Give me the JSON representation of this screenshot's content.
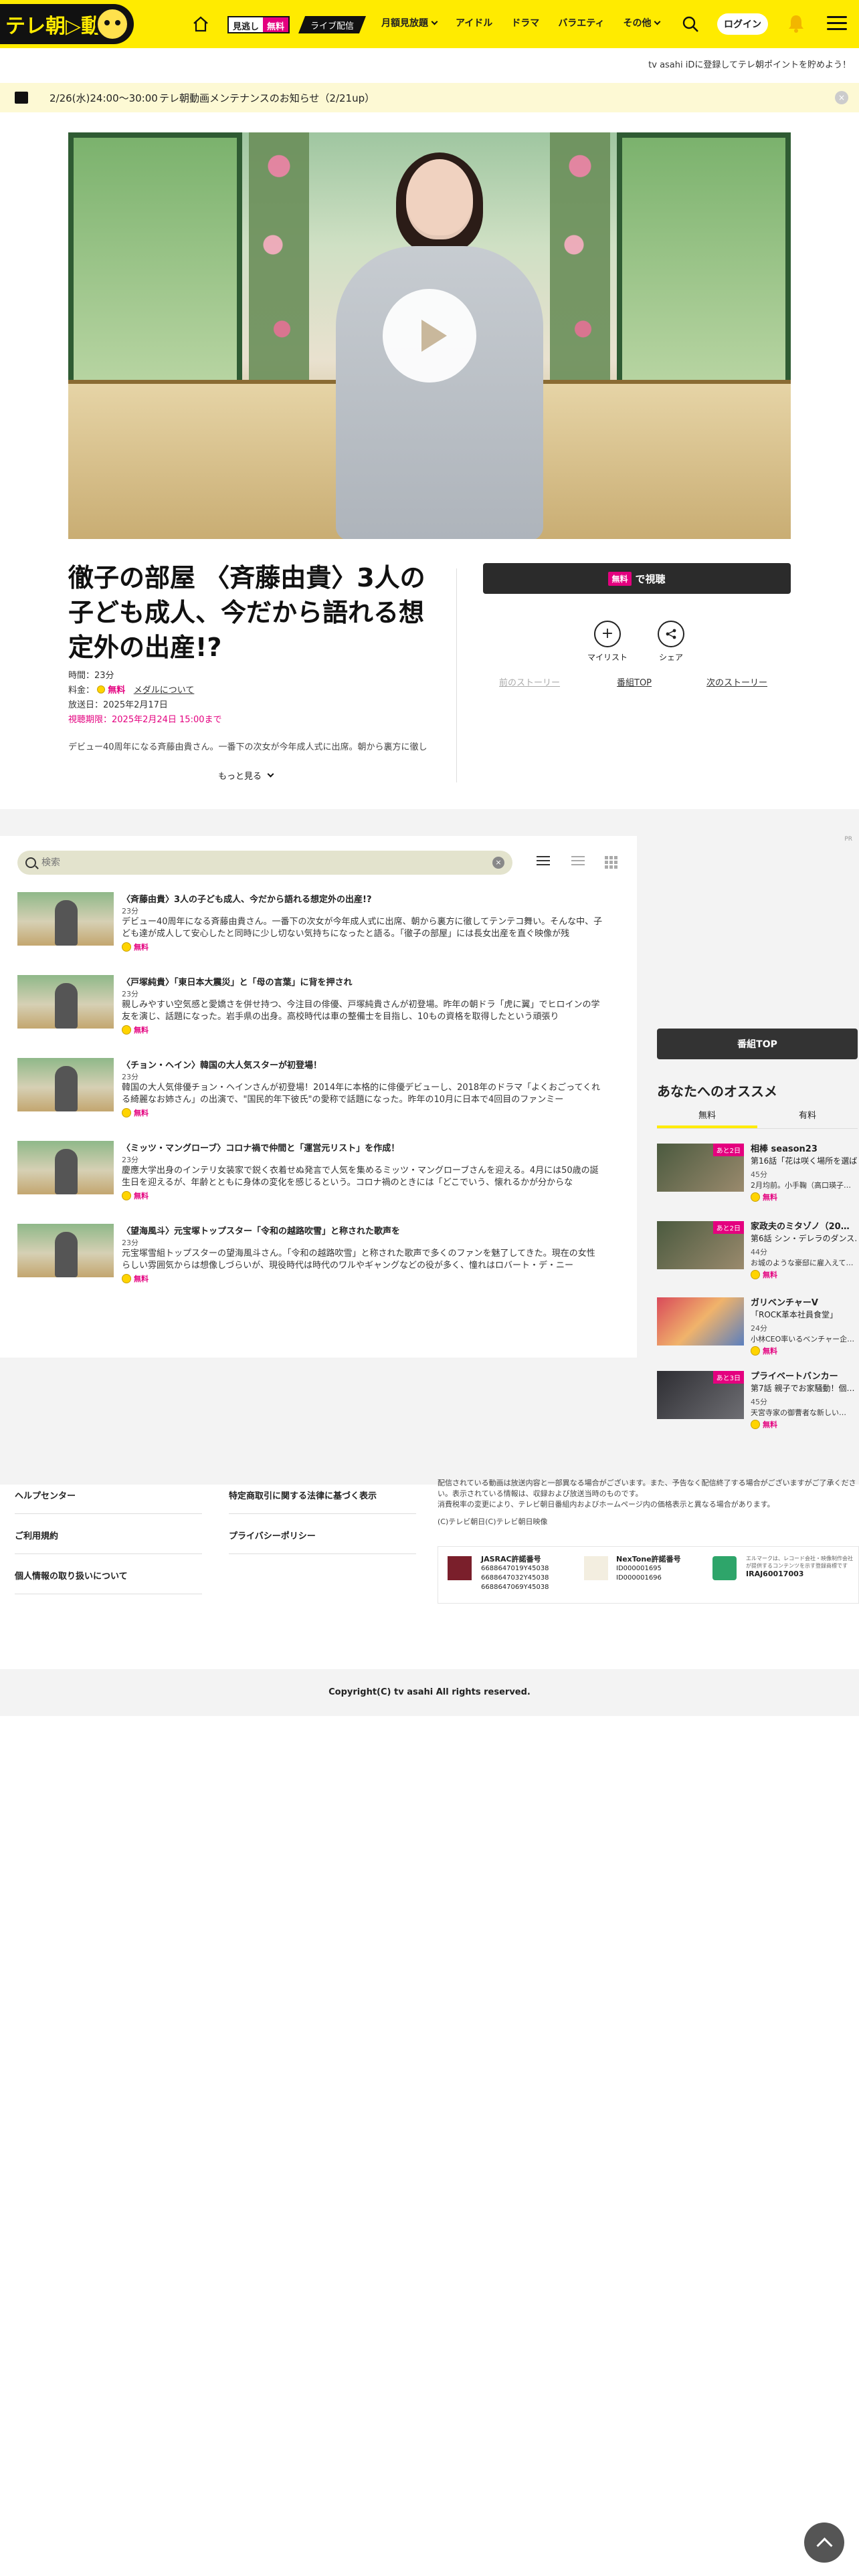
{
  "header": {
    "logo": "テレ朝▷動画",
    "mi_badge": "見逃し",
    "mi_free": "無料",
    "live_badge": "ライブ配信",
    "nav": [
      {
        "label": "月額見放題",
        "has_dropdown": true
      },
      {
        "label": "アイドル",
        "has_dropdown": false
      },
      {
        "label": "ドラマ",
        "has_dropdown": false
      },
      {
        "label": "バラエティ",
        "has_dropdown": false
      },
      {
        "label": "その他",
        "has_dropdown": true
      }
    ],
    "login_label": "ログイン",
    "accent": "#ffeb00"
  },
  "promo_text": "tv asahi iDに登録してテレ朝ポイントを貯めよう！",
  "notice": {
    "date": "2/26(水)24:00〜30:00",
    "text": "テレ朝動画メンテナンスのお知らせ（2/21up）",
    "close": "×"
  },
  "episode": {
    "title": "徹子の部屋 〈斉藤由貴〉3人の子ども成人、今だから語れる想定外の出産!?",
    "duration_label": "時間：23分",
    "fee_label": "料金：",
    "fee_value": "無料",
    "fee_link": "メダルについて",
    "aired": "放送日：2025年2月17日",
    "deadline": "視聴期限：2025年2月24日 15:00まで",
    "description": "デビュー40周年になる斉藤由貴さん。一番下の次女が今年成人式に出席。朝から裏方に徹し",
    "more_label": "もっと見る",
    "watch_free_badge": "無料",
    "watch_label": "で視聴",
    "mylist_label": "マイリスト",
    "share_label": "シェア",
    "prev_label": "前のストーリー",
    "top_label": "番組TOP",
    "next_label": "次のストーリー"
  },
  "corner_tag": "PR",
  "episode_list": {
    "search_placeholder": "検索",
    "items": [
      {
        "title": "〈斉藤由貴〉3人の子ども成人、今だから語れる想定外の出産!?",
        "duration": "23分",
        "desc": "デビュー40周年になる斉藤由貴さん。一番下の次女が今年成人式に出席、朝から裏方に徹してテンテコ舞い。そんな中、子ども達が成人して安心したと同時に少し切ない気持ちになったと語る。「徹子の部屋」には長女出産を直ぐ映像が残",
        "free": "無料"
      },
      {
        "title": "〈戸塚純貴〉「東日本大震災」と「母の言葉」に背を押され",
        "duration": "23分",
        "desc": "親しみやすい空気感と愛嬌さを併せ持つ、今注目の俳優、戸塚純貴さんが初登場。昨年の朝ドラ「虎に翼」でヒロインの学友を演じ、話題になった。岩手県の出身。高校時代は車の整備士を目指し、10もの資格を取得したという頑張り",
        "free": "無料"
      },
      {
        "title": "〈チョン・ヘイン〉韓国の大人気スターが初登場！",
        "duration": "23分",
        "desc": "韓国の大人気俳優チョン・ヘインさんが初登場！2014年に本格的に俳優デビューし、2018年のドラマ「よくおごってくれる綺麗なお姉さん」の出演で、\"国民的年下彼氏\"の愛称で話題になった。昨年の10月に日本で4回目のファンミー",
        "free": "無料"
      },
      {
        "title": "〈ミッツ・マングローブ〉コロナ禍で仲間と「運営元リスト」を作成！",
        "duration": "23分",
        "desc": "慶應大学出身のインテリ女装家で鋭く衣着せぬ発言で人気を集めるミッツ・マングローブさんを迎える。4月には50歳の誕生日を迎えるが、年齢とともに身体の変化を感じるという。コロナ禍のときには「どこでいう、懐れるかが分からな",
        "free": "無料"
      },
      {
        "title": "〈望海風斗〉元宝塚トップスター「令和の越路吹雪」と称された歌声を",
        "duration": "23分",
        "desc": "元宝塚雪組トップスターの望海風斗さん。「令和の越路吹雪」と称された歌声で多くのファンを魅了してきた。現在の女性らしい雰囲気からは想像しづらいが、現役時代は時代のワルやギャングなどの役が多く、憧れはロバート・デ・ニー",
        "free": "無料"
      }
    ]
  },
  "sidebar": {
    "top_button": "番組TOP",
    "rec_title": "あなたへのオススメ",
    "tabs": [
      "無料",
      "有料"
    ],
    "items": [
      {
        "badge": "あと2日",
        "title": "相棒 season23",
        "sub": "第16話「花は咲く場所を選ば…",
        "duration": "45分",
        "extra": "2月均前。小手鞠（高口瑛子…",
        "free": "無料"
      },
      {
        "badge": "あと2日",
        "title": "家政夫のミタゾノ（20…",
        "sub": "第6話 シン・デレラのダンス…",
        "duration": "44分",
        "extra": "お城のような豪邸に雇入えて…",
        "free": "無料"
      },
      {
        "badge": "",
        "title": "ガリベンチャーV",
        "sub": "「ROCK革本社員食堂」",
        "duration": "24分",
        "extra": "小林CEO率いるベンチャー企…",
        "free": "無料"
      },
      {
        "badge": "あと3日",
        "title": "プライベートバンカー",
        "sub": "第7話 親子でお家騒動！個…",
        "duration": "45分",
        "extra": "天宮寺家の御曹者な新しい…",
        "free": "無料"
      }
    ]
  },
  "footer": {
    "links": [
      "ヘルプセンター",
      "特定商取引に関する法律に基づく表示",
      "ご利用規約",
      "プライバシーポリシー",
      "個人情報の取り扱いについて"
    ],
    "note1": "配信されている動画は放送内容と一部異なる場合がございます。また、予告なく配信終了する場合がございますがご了承ください。表示されている情報は、収録および放送当時のものです。",
    "note2": "消費税率の変更により、テレビ朝日番組内およびホームページ内の価格表示と異なる場合があります。",
    "note3": "(C)テレビ朝日(C)テレビ朝日映像",
    "jasrac_title": "JASRAC許諾番号",
    "jasrac_nums": [
      "6688647019Y45038",
      "6688647032Y45038",
      "6688647069Y45038"
    ],
    "nextone_title": "NexTone許諾番号",
    "nextone_nums": [
      "ID000001695",
      "ID000001696"
    ],
    "lmark_text": "エルマークは、レコード会社・映像制作会社が提供するコンテンツを示す登録商標です",
    "lmark_num": "IRAJ60017003",
    "copyright": "Copyright(C) tv asahi All rights reserved."
  }
}
